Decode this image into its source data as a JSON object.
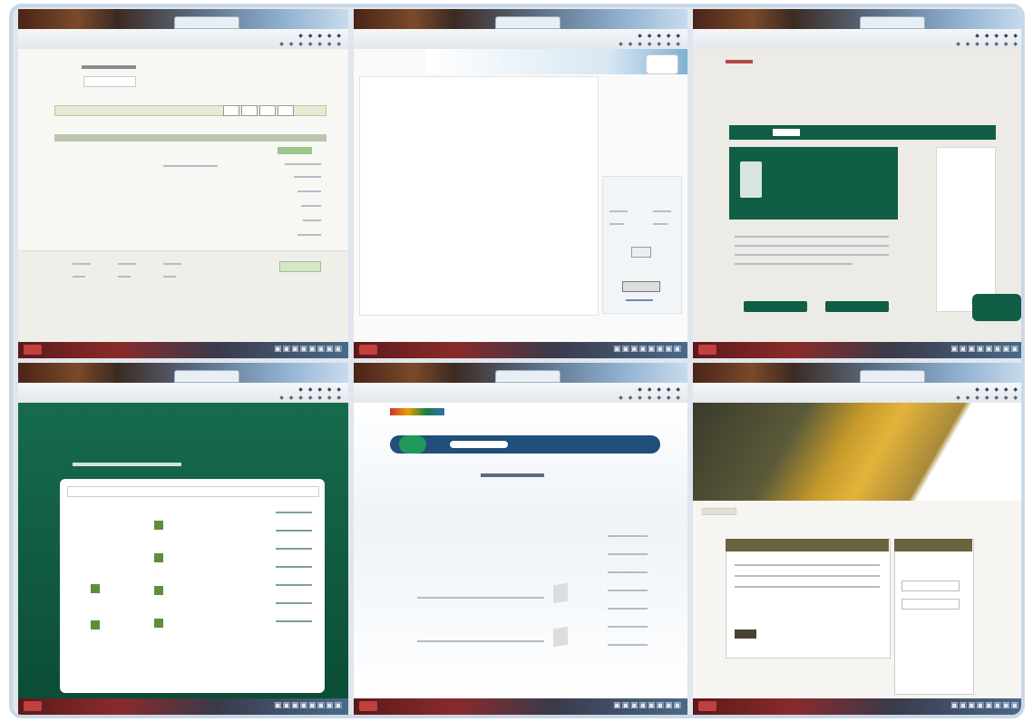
{
  "screens": [
    {
      "id": "s1",
      "tab": "",
      "heading": "",
      "field": ""
    },
    {
      "id": "s2",
      "tab": "",
      "field": ""
    },
    {
      "id": "s3",
      "tab": "",
      "logo": ""
    },
    {
      "id": "s4",
      "tab": ""
    },
    {
      "id": "s5",
      "tab": ""
    },
    {
      "id": "s6",
      "tab": ""
    }
  ],
  "taskbar": {
    "start_label": "",
    "app_icons": "▣▣▣▣▣▣▣▣"
  },
  "toolbar": {
    "row1": "◆ ◆ ◆ ◆ ◆",
    "row2": "◆ ◆ ◆ ◆ ◆ ◆ ◆"
  },
  "colors": {
    "green": "#0f5e45",
    "olive": "#6b6240",
    "amber": "#d9a23a",
    "frame": "#c9d8e8"
  }
}
